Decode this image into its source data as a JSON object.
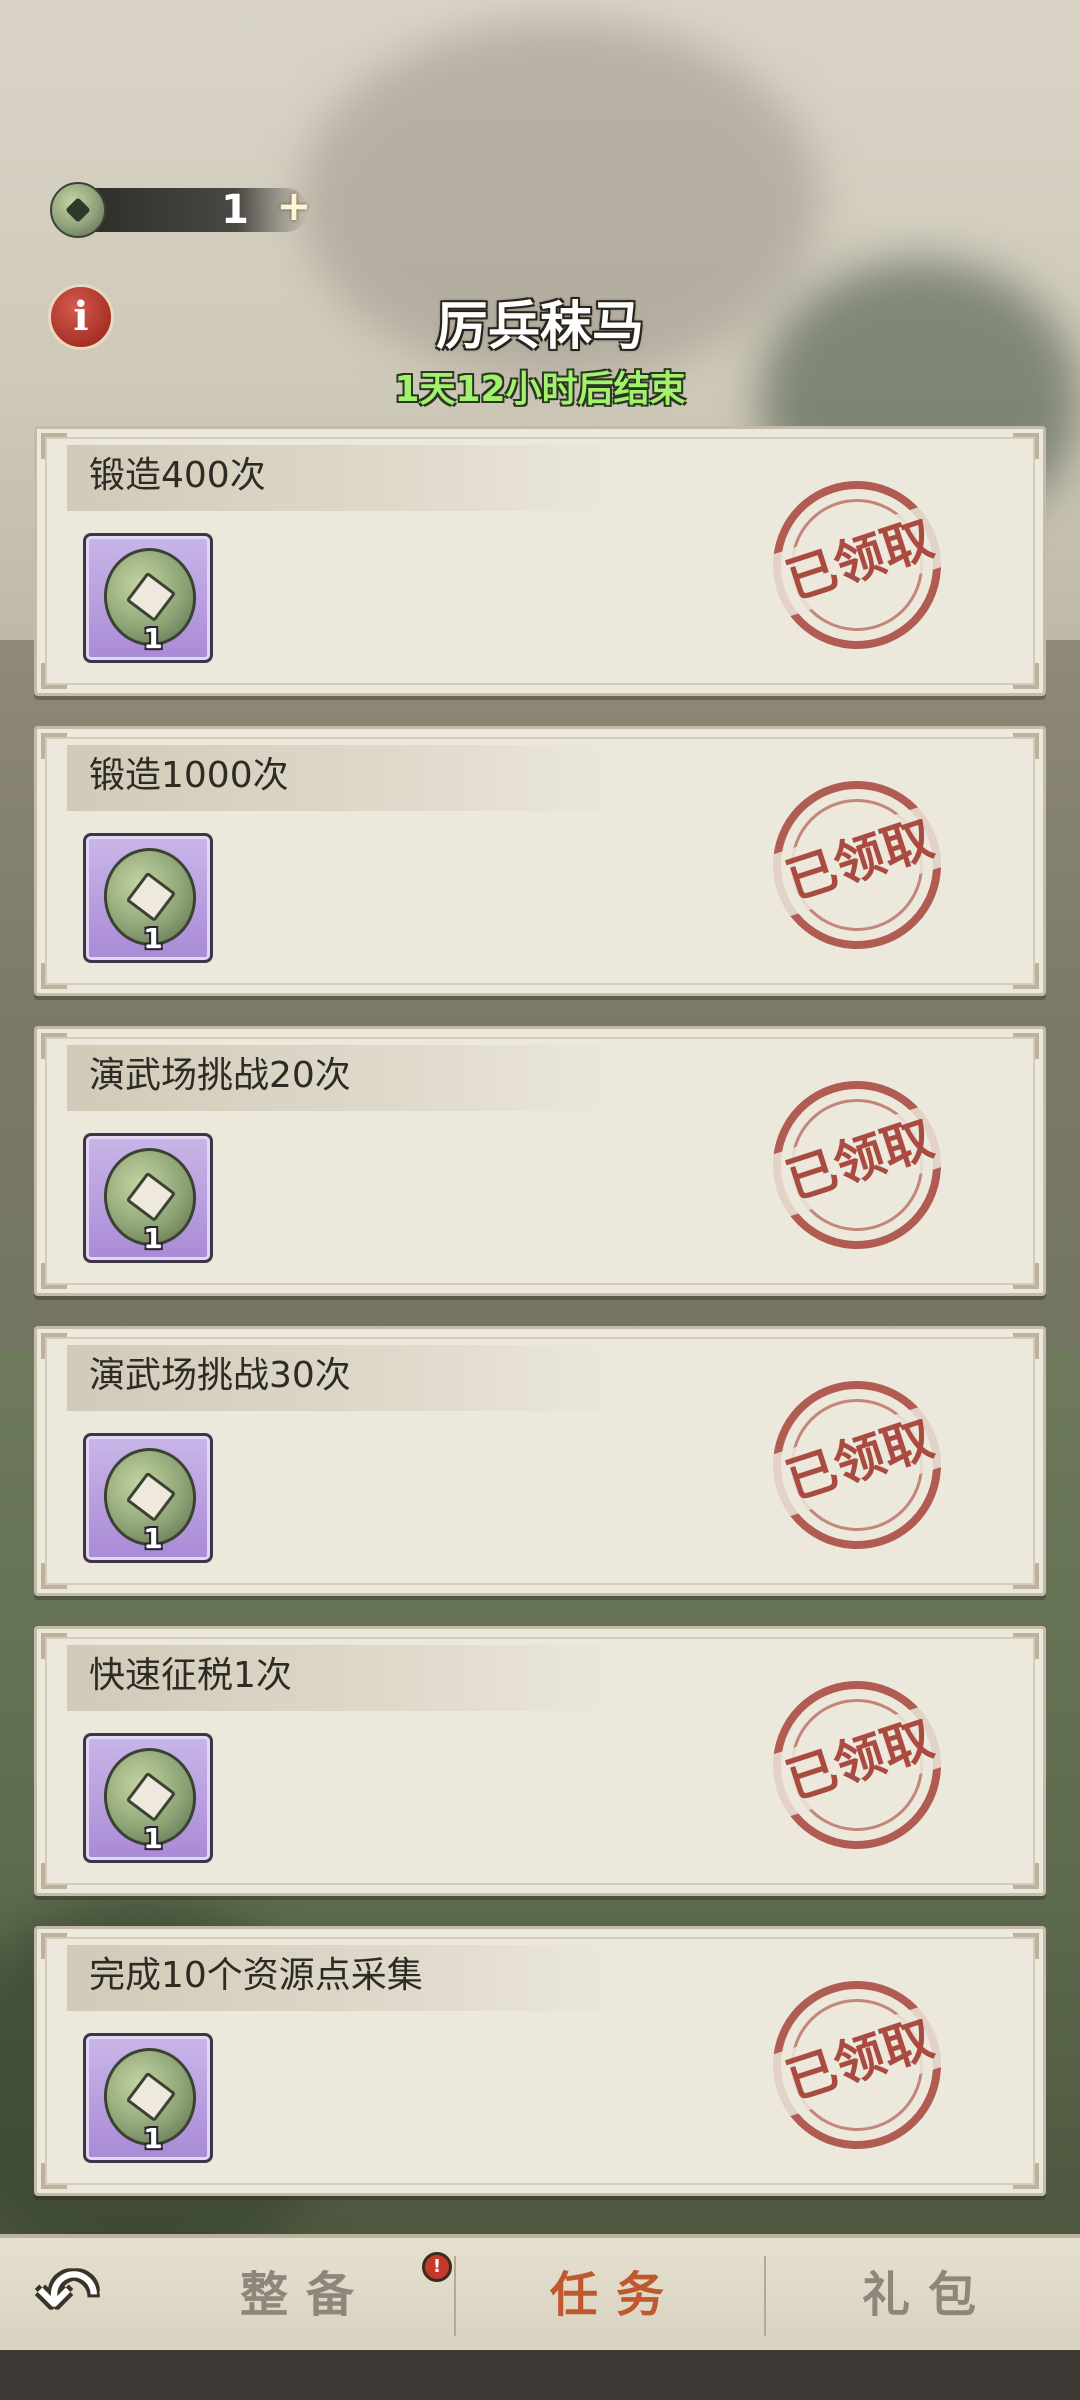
{
  "currency": {
    "amount": "1",
    "plus": "+",
    "icon": "coin-icon"
  },
  "header": {
    "title": "厉兵秣马",
    "countdown": "1天12小时后结束",
    "info_icon": "info-icon",
    "info_glyph": "i"
  },
  "tasks": [
    {
      "label": "锻造400次",
      "reward_qty": "1",
      "status": "已领取"
    },
    {
      "label": "锻造1000次",
      "reward_qty": "1",
      "status": "已领取"
    },
    {
      "label": "演武场挑战20次",
      "reward_qty": "1",
      "status": "已领取"
    },
    {
      "label": "演武场挑战30次",
      "reward_qty": "1",
      "status": "已领取"
    },
    {
      "label": "快速征税1次",
      "reward_qty": "1",
      "status": "已领取"
    },
    {
      "label": "完成10个资源点采集",
      "reward_qty": "1",
      "status": "已领取"
    }
  ],
  "nav": {
    "back_glyph": "↶",
    "tabs": [
      {
        "label": "整备",
        "alert": "!"
      },
      {
        "label": "任务",
        "active": true
      },
      {
        "label": "礼包"
      }
    ]
  },
  "colors": {
    "countdown": "#a3f26d",
    "active_tab": "#c0582e",
    "stamp": "#a0342c",
    "reward_bg": "#b39ade"
  }
}
